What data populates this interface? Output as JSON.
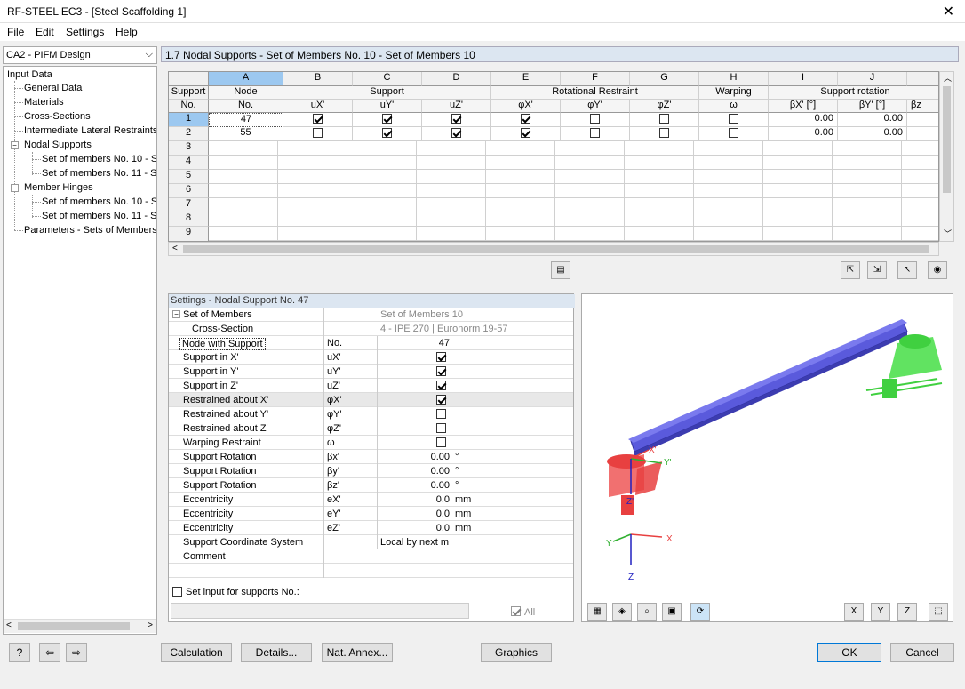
{
  "window": {
    "title": "RF-STEEL EC3 - [Steel Scaffolding 1]",
    "close": "✕"
  },
  "menu": [
    "File",
    "Edit",
    "Settings",
    "Help"
  ],
  "case_select": "CA2 - PIFM Design",
  "tree": {
    "root": "Input Data",
    "items": [
      "General Data",
      "Materials",
      "Cross-Sections",
      "Intermediate Lateral Restraints",
      "Nodal Supports",
      "Set of members No. 10 - Se",
      "Set of members No. 11 - Se",
      "Member Hinges",
      "Set of members No. 10 - Se",
      "Set of members No. 11 - Se",
      "Parameters - Sets of Members"
    ]
  },
  "section_title": "1.7 Nodal Supports - Set of Members No. 10 - Set of Members 10",
  "grid": {
    "col_letters": [
      "A",
      "B",
      "C",
      "D",
      "E",
      "F",
      "G",
      "H",
      "I",
      "J"
    ],
    "support_no": [
      "Support",
      "No."
    ],
    "node": [
      "Node",
      "No."
    ],
    "groups": {
      "support": "Support",
      "rotational": "Rotational Restraint",
      "warping": "Warping",
      "rotation": "Support rotation"
    },
    "subheads": [
      "uX'",
      "uY'",
      "uZ'",
      "φX'",
      "φY'",
      "φZ'",
      "ω",
      "βX' [°]",
      "βY' [°]",
      "βz"
    ],
    "rows": [
      {
        "no": "1",
        "node": "47",
        "checks": [
          true,
          true,
          true,
          true,
          false,
          false,
          false
        ],
        "bx": "0.00",
        "by": "0.00"
      },
      {
        "no": "2",
        "node": "55",
        "checks": [
          false,
          true,
          true,
          true,
          false,
          false,
          false
        ],
        "bx": "0.00",
        "by": "0.00"
      }
    ],
    "empty_rows": [
      "3",
      "4",
      "5",
      "6",
      "7",
      "8",
      "9"
    ]
  },
  "settings": {
    "title": "Settings - Nodal Support No. 47",
    "rows": [
      {
        "label": "Set of Members",
        "sym": "",
        "value": "Set of Members 10",
        "unit": ""
      },
      {
        "label": "Cross-Section",
        "sym": "",
        "value": "4 - IPE 270 | Euronorm 19-57",
        "unit": ""
      },
      {
        "label": "Node with Support",
        "sym": "No.",
        "value": "47",
        "unit": ""
      },
      {
        "label": "Support in X'",
        "sym": "uX'",
        "check": true
      },
      {
        "label": "Support in Y'",
        "sym": "uY'",
        "check": true
      },
      {
        "label": "Support in Z'",
        "sym": "uZ'",
        "check": true
      },
      {
        "label": "Restrained about X'",
        "sym": "φX'",
        "check": true
      },
      {
        "label": "Restrained about Y'",
        "sym": "φY'",
        "check": false
      },
      {
        "label": "Restrained about Z'",
        "sym": "φZ'",
        "check": false
      },
      {
        "label": "Warping Restraint",
        "sym": "ω",
        "check": false
      },
      {
        "label": "Support Rotation",
        "sym": "βx'",
        "value": "0.00",
        "unit": "°"
      },
      {
        "label": "Support Rotation",
        "sym": "βy'",
        "value": "0.00",
        "unit": "°"
      },
      {
        "label": "Support Rotation",
        "sym": "βz'",
        "value": "0.00",
        "unit": "°"
      },
      {
        "label": "Eccentricity",
        "sym": "eX'",
        "value": "0.0",
        "unit": "mm"
      },
      {
        "label": "Eccentricity",
        "sym": "eY'",
        "value": "0.0",
        "unit": "mm"
      },
      {
        "label": "Eccentricity",
        "sym": "eZ'",
        "value": "0.0",
        "unit": "mm"
      },
      {
        "label": "Support Coordinate System",
        "sym": "",
        "value": "Local by next m",
        "unit": ""
      },
      {
        "label": "Comment",
        "sym": "",
        "value": "",
        "unit": ""
      }
    ],
    "set_input": "Set input for supports No.:",
    "all": "All"
  },
  "graphic": {
    "labels": {
      "x_beam": "X'",
      "y_beam": "Y'",
      "z_beam": "Z'",
      "ax_x": "X",
      "ax_y": "Y",
      "ax_z": "Z"
    }
  },
  "buttons": {
    "calculation": "Calculation",
    "details": "Details...",
    "nat_annex": "Nat. Annex...",
    "graphics": "Graphics",
    "ok": "OK",
    "cancel": "Cancel"
  },
  "colors": {
    "beam": "#5a5adc",
    "support_red": "#e84040",
    "support_green": "#40d040"
  }
}
